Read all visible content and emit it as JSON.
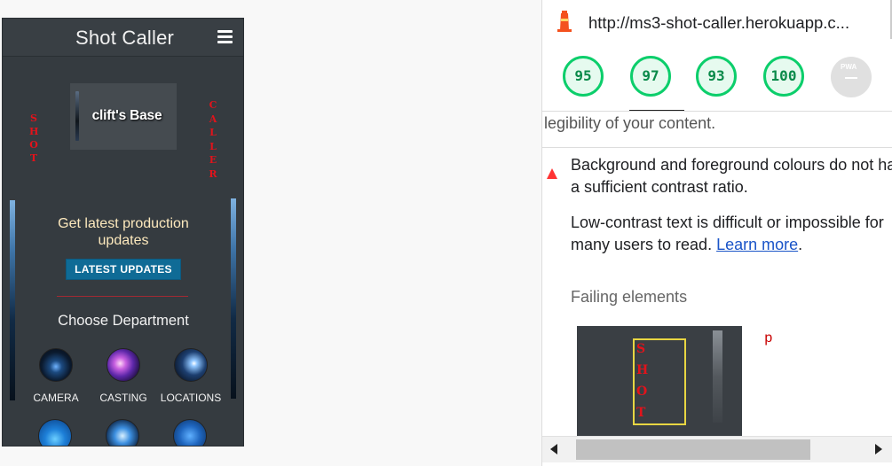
{
  "app": {
    "title": "Shot Caller",
    "side_word_left": "SHOT",
    "side_word_right": "CALLER",
    "base_card_label": "clift's Base",
    "updates_text": "Get latest production updates",
    "updates_button": "LATEST UPDATES",
    "departments_title": "Choose Department",
    "departments": [
      {
        "label": "CAMERA"
      },
      {
        "label": "CASTING"
      },
      {
        "label": "LOCATIONS"
      }
    ]
  },
  "devtools": {
    "url": "http://ms3-shot-caller.herokuapp.c...",
    "scores": [
      "95",
      "97",
      "93",
      "100"
    ],
    "pwa_label": "PWA",
    "score_color": "#0cce6b",
    "legibility_text": "legibility of your content.",
    "audit_title": "Background and foreground colours do not have a sufficient contrast ratio.",
    "audit_desc_prefix": "Low-contrast text is difficult or impossible for many users to read.",
    "learn_more": "Learn more",
    "audit_desc_suffix": ".",
    "failing_label": "Failing elements",
    "thumb_letters": [
      "S",
      "H",
      "O",
      "T"
    ],
    "element_tag": "p",
    "fail_color": "#ff3333"
  }
}
